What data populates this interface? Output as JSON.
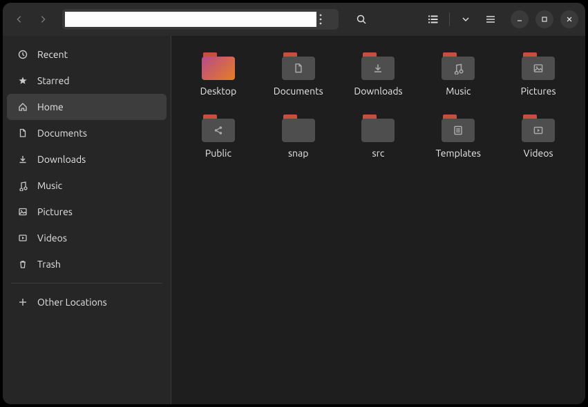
{
  "sidebar": {
    "items": [
      {
        "label": "Recent",
        "icon": "clock"
      },
      {
        "label": "Starred",
        "icon": "star"
      },
      {
        "label": "Home",
        "icon": "home",
        "active": true
      },
      {
        "label": "Documents",
        "icon": "document"
      },
      {
        "label": "Downloads",
        "icon": "download"
      },
      {
        "label": "Music",
        "icon": "music"
      },
      {
        "label": "Pictures",
        "icon": "pictures"
      },
      {
        "label": "Videos",
        "icon": "videos"
      },
      {
        "label": "Trash",
        "icon": "trash"
      }
    ],
    "other_label": "Other Locations"
  },
  "path_value": "",
  "folders": [
    {
      "name": "Desktop",
      "glyph": "desktop"
    },
    {
      "name": "Documents",
      "glyph": "document"
    },
    {
      "name": "Downloads",
      "glyph": "download"
    },
    {
      "name": "Music",
      "glyph": "music"
    },
    {
      "name": "Pictures",
      "glyph": "pictures"
    },
    {
      "name": "Public",
      "glyph": "share"
    },
    {
      "name": "snap",
      "glyph": ""
    },
    {
      "name": "src",
      "glyph": ""
    },
    {
      "name": "Templates",
      "glyph": "templates"
    },
    {
      "name": "Videos",
      "glyph": "videos"
    }
  ]
}
